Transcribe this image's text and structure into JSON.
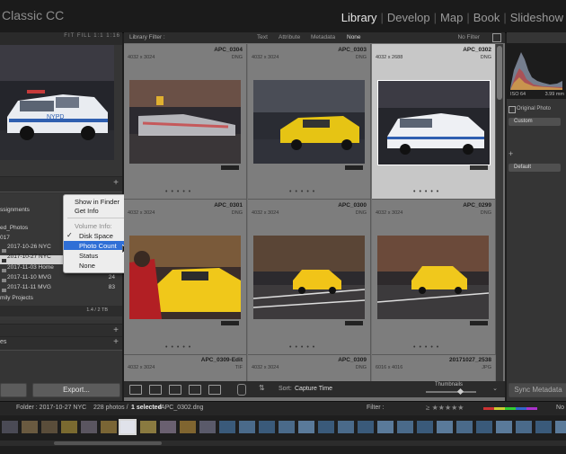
{
  "app": {
    "title": "Classic CC"
  },
  "modules": {
    "items": [
      "Library",
      "Develop",
      "Map",
      "Book",
      "Slideshow"
    ],
    "active": "Library",
    "separator": "|"
  },
  "navigator": {
    "zoom_options": "FIT   FILL   1:1   1:16"
  },
  "folders": {
    "rows": [
      {
        "label": "ssignments",
        "count": ""
      },
      {
        "label": "ed_Photos",
        "count": ""
      },
      {
        "label": "017",
        "count": ""
      },
      {
        "label": "2017-10-26 NYC",
        "count": ""
      },
      {
        "label": "2017-10-27 NYC",
        "count": ""
      },
      {
        "label": "2017-11-03 Home",
        "count": ""
      },
      {
        "label": "2017-11-10 MVG",
        "count": "24"
      },
      {
        "label": "2017-11-11 MVG",
        "count": "83"
      },
      {
        "label": "mily Projects",
        "count": ""
      }
    ],
    "disk_usage": "1.4 / 2 TB"
  },
  "context_menu": {
    "items": [
      {
        "label": "Show in Finder",
        "state": "normal"
      },
      {
        "label": "Get Info",
        "state": "normal"
      },
      {
        "label": "Volume Info:",
        "state": "dim"
      },
      {
        "label": "Disk Space",
        "state": "checked"
      },
      {
        "label": "Photo Count",
        "state": "highlighted"
      },
      {
        "label": "Status",
        "state": "normal"
      },
      {
        "label": "None",
        "state": "normal"
      }
    ]
  },
  "left_footer": {
    "export_label": "Export...",
    "collections_label": "es"
  },
  "filter_bar": {
    "label": "Library Filter :",
    "options": [
      "Text",
      "Attribute",
      "Metadata",
      "None"
    ],
    "active": "None",
    "preset": "No Filter"
  },
  "grid": {
    "cells": [
      {
        "name": "APC_0304",
        "dims": "4032 x 3024",
        "format": "DNG",
        "selected": false
      },
      {
        "name": "APC_0303",
        "dims": "4032 x 3024",
        "format": "DNG",
        "selected": false
      },
      {
        "name": "APC_0302",
        "dims": "4032 x 2688",
        "format": "DNG",
        "selected": true
      },
      {
        "name": "APC_0301",
        "dims": "4032 x 3024",
        "format": "DNG",
        "selected": false
      },
      {
        "name": "APC_0300",
        "dims": "4032 x 3024",
        "format": "DNG",
        "selected": false
      },
      {
        "name": "APC_0299",
        "dims": "4032 x 3024",
        "format": "DNG",
        "selected": false
      },
      {
        "name": "APC_0309-Edit",
        "dims": "4032 x 3024",
        "format": "TIF",
        "selected": false
      },
      {
        "name": "APC_0309",
        "dims": "4032 x 3024",
        "format": "DNG",
        "selected": false
      },
      {
        "name": "20171027_2538",
        "dims": "6016 x 4016",
        "format": "JPG",
        "selected": false
      }
    ]
  },
  "toolbar": {
    "sort_label": "Sort:",
    "sort_value": "Capture Time",
    "thumbnails_label": "Thumbnails"
  },
  "histogram": {
    "iso": "ISO 64",
    "focal": "3.99 mm",
    "original_photo": "Original Photo",
    "custom": "Custom",
    "default": "Default"
  },
  "right_footer": {
    "sync_label": "Sync Metadata"
  },
  "filmstrip_bar": {
    "folder_text": "Folder : 2017-10-27 NYC",
    "count_text": "228 photos /",
    "selected_text": "1 selected",
    "file_text": "/APC_0302.dng",
    "filter_label": "Filter :",
    "no_label": "No"
  }
}
